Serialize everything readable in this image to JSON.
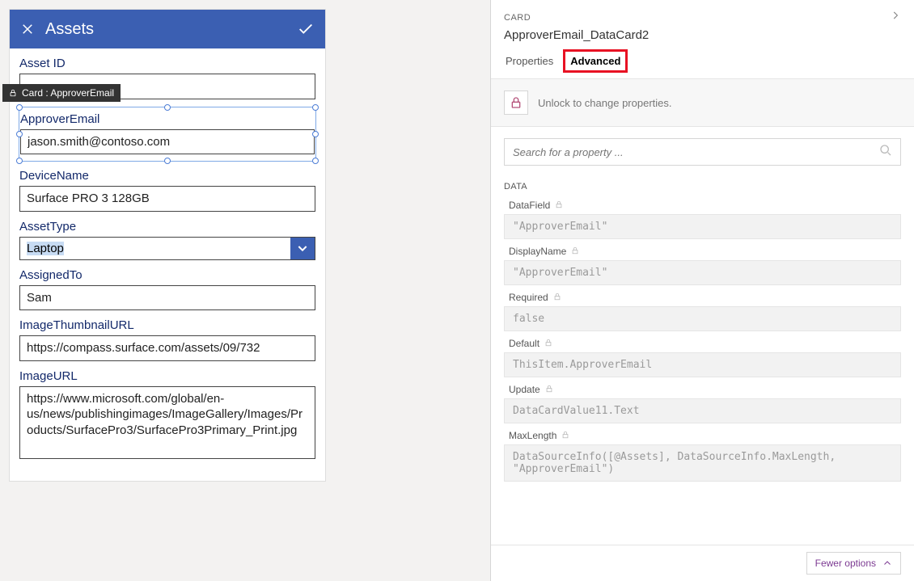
{
  "form": {
    "title": "Assets",
    "tooltip_prefix": "Card :",
    "tooltip": "ApproverEmail",
    "fields": {
      "assetId": {
        "label": "Asset ID",
        "value": ""
      },
      "approverEmail": {
        "label": "ApproverEmail",
        "value": "jason.smith@contoso.com"
      },
      "deviceName": {
        "label": "DeviceName",
        "value": "Surface PRO 3 128GB"
      },
      "assetType": {
        "label": "AssetType",
        "value": "Laptop"
      },
      "assignedTo": {
        "label": "AssignedTo",
        "value": "Sam"
      },
      "thumbUrl": {
        "label": "ImageThumbnailURL",
        "value": "https://compass.surface.com/assets/09/732"
      },
      "imageUrl": {
        "label": "ImageURL",
        "value": "https://www.microsoft.com/global/en-us/news/publishingimages/ImageGallery/Images/Products/SurfacePro3/SurfacePro3Primary_Print.jpg"
      }
    }
  },
  "panel": {
    "kicker": "CARD",
    "name": "ApproverEmail_DataCard2",
    "tabs": {
      "properties": "Properties",
      "advanced": "Advanced"
    },
    "lock_text": "Unlock to change properties.",
    "search_placeholder": "Search for a property ...",
    "section": "DATA",
    "props": {
      "DataField": {
        "label": "DataField",
        "value": "\"ApproverEmail\""
      },
      "DisplayName": {
        "label": "DisplayName",
        "value": "\"ApproverEmail\""
      },
      "Required": {
        "label": "Required",
        "value": "false"
      },
      "Default": {
        "label": "Default",
        "value": "ThisItem.ApproverEmail"
      },
      "Update": {
        "label": "Update",
        "value": "DataCardValue11.Text"
      },
      "MaxLength": {
        "label": "MaxLength",
        "value": "DataSourceInfo([@Assets], DataSourceInfo.MaxLength, \"ApproverEmail\")"
      }
    },
    "fewer": "Fewer options"
  }
}
